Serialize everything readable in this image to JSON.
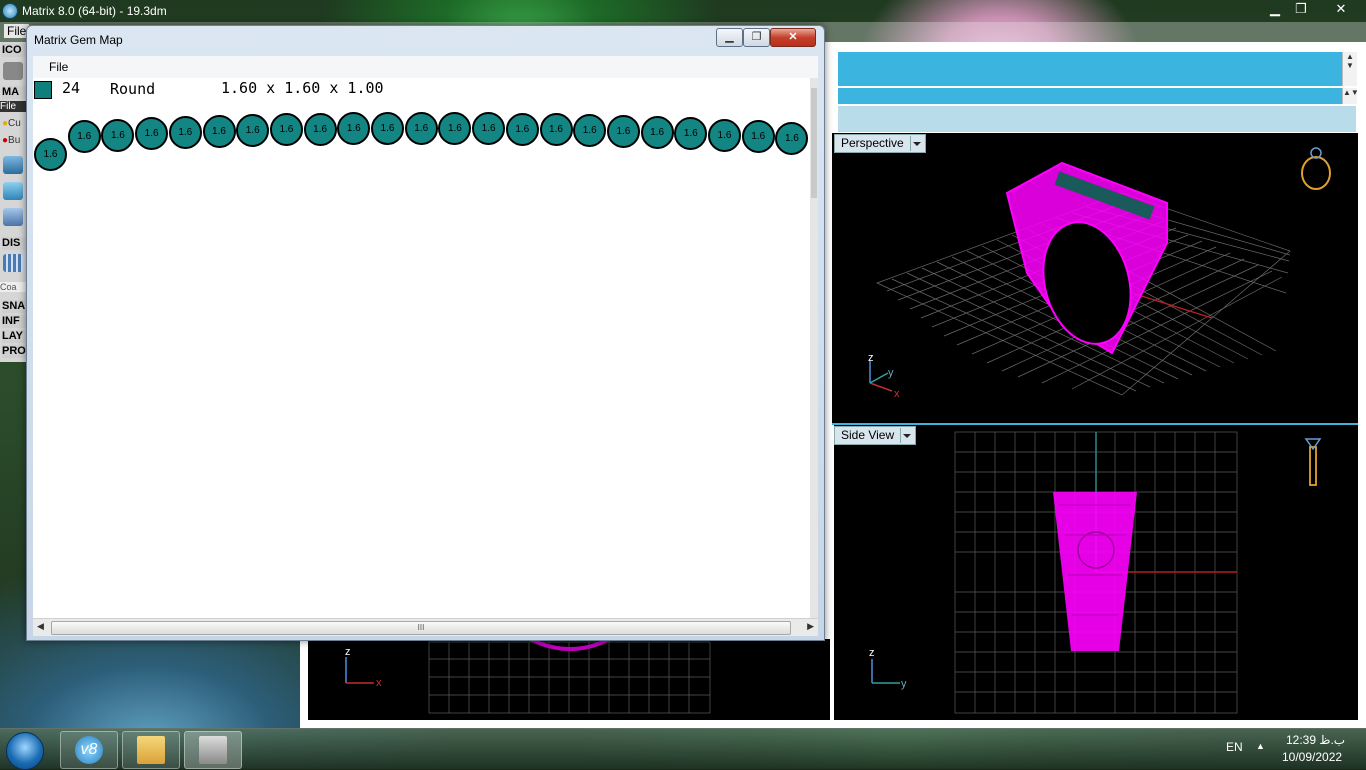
{
  "main_window": {
    "title": "Matrix 8.0 (64-bit) - 19.3dm",
    "menu_file": "File",
    "minimize": "▁",
    "restore": "❐",
    "close": "✕"
  },
  "left_panel": {
    "items": [
      "ICO",
      "MA",
      "File",
      "Cu",
      "Bu",
      "DIS",
      "Coa",
      "SNA",
      "INF",
      "LAY",
      "PRO"
    ]
  },
  "viewports": {
    "perspective": {
      "label": "Perspective",
      "axis_z": "z",
      "axis_y": "y",
      "axis_x": "x"
    },
    "side": {
      "label": "Side View",
      "axis_z": "z",
      "axis_y": "y"
    },
    "front": {
      "axis_z": "z",
      "axis_x": "x"
    }
  },
  "gem_map": {
    "title": "Matrix Gem Map",
    "menu_file": "File",
    "row": {
      "count": "24",
      "shape": "Round",
      "size": "1.60 x 1.60 x 1.00",
      "color": "#0e7f7b"
    },
    "gem_label": "1.6",
    "gem_count": 23,
    "minimize": "▁",
    "restore": "❐",
    "close": "✕",
    "hscroll_grip": "III"
  },
  "taskbar": {
    "language": "EN",
    "time": "12:39 ب.ظ",
    "date": "10/09/2022",
    "tray_arrow": "▲"
  },
  "colors": {
    "accent": "#3bb4e0",
    "ring": "#ff00ff",
    "gem": "#138684"
  }
}
